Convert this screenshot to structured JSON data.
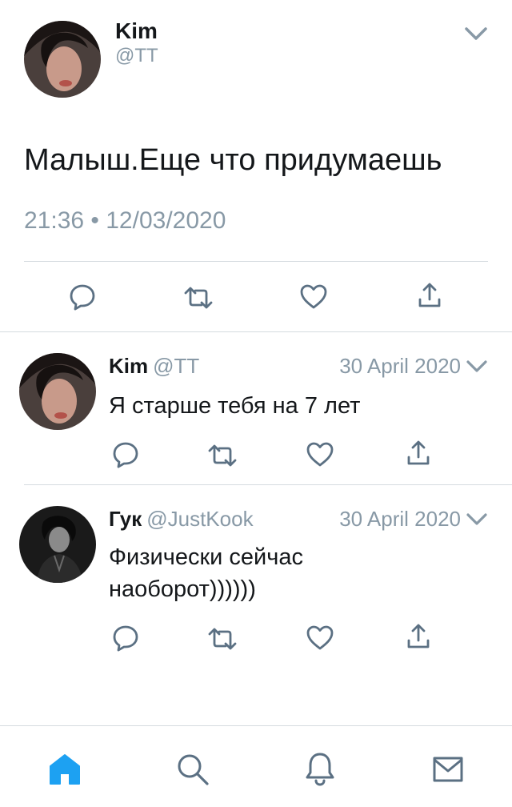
{
  "main_tweet": {
    "author_name": "Kim",
    "author_handle": "@TT",
    "text": "Малыш.Еще что придумаешь",
    "meta": "21:36 • 12/03/2020",
    "actions": {
      "reply_icon": "reply-icon",
      "retweet_icon": "retweet-icon",
      "like_icon": "heart-icon",
      "share_icon": "share-icon"
    }
  },
  "replies": [
    {
      "author_name": "Kim",
      "author_handle": "@TT",
      "date": "30 April 2020",
      "text": "Я старше тебя на 7 лет"
    },
    {
      "author_name": "Гук",
      "author_handle": "@JustKook",
      "date": "30 April 2020",
      "text": "Физически сейчас наоборот))))))"
    }
  ],
  "tabbar": {
    "items": [
      "home-icon",
      "search-icon",
      "bell-icon",
      "mail-icon"
    ],
    "active": "home-icon"
  },
  "colors": {
    "accent": "#1da1f2",
    "text": "#14171a",
    "secondary": "#8899a6",
    "divider": "#d5dbe0"
  }
}
